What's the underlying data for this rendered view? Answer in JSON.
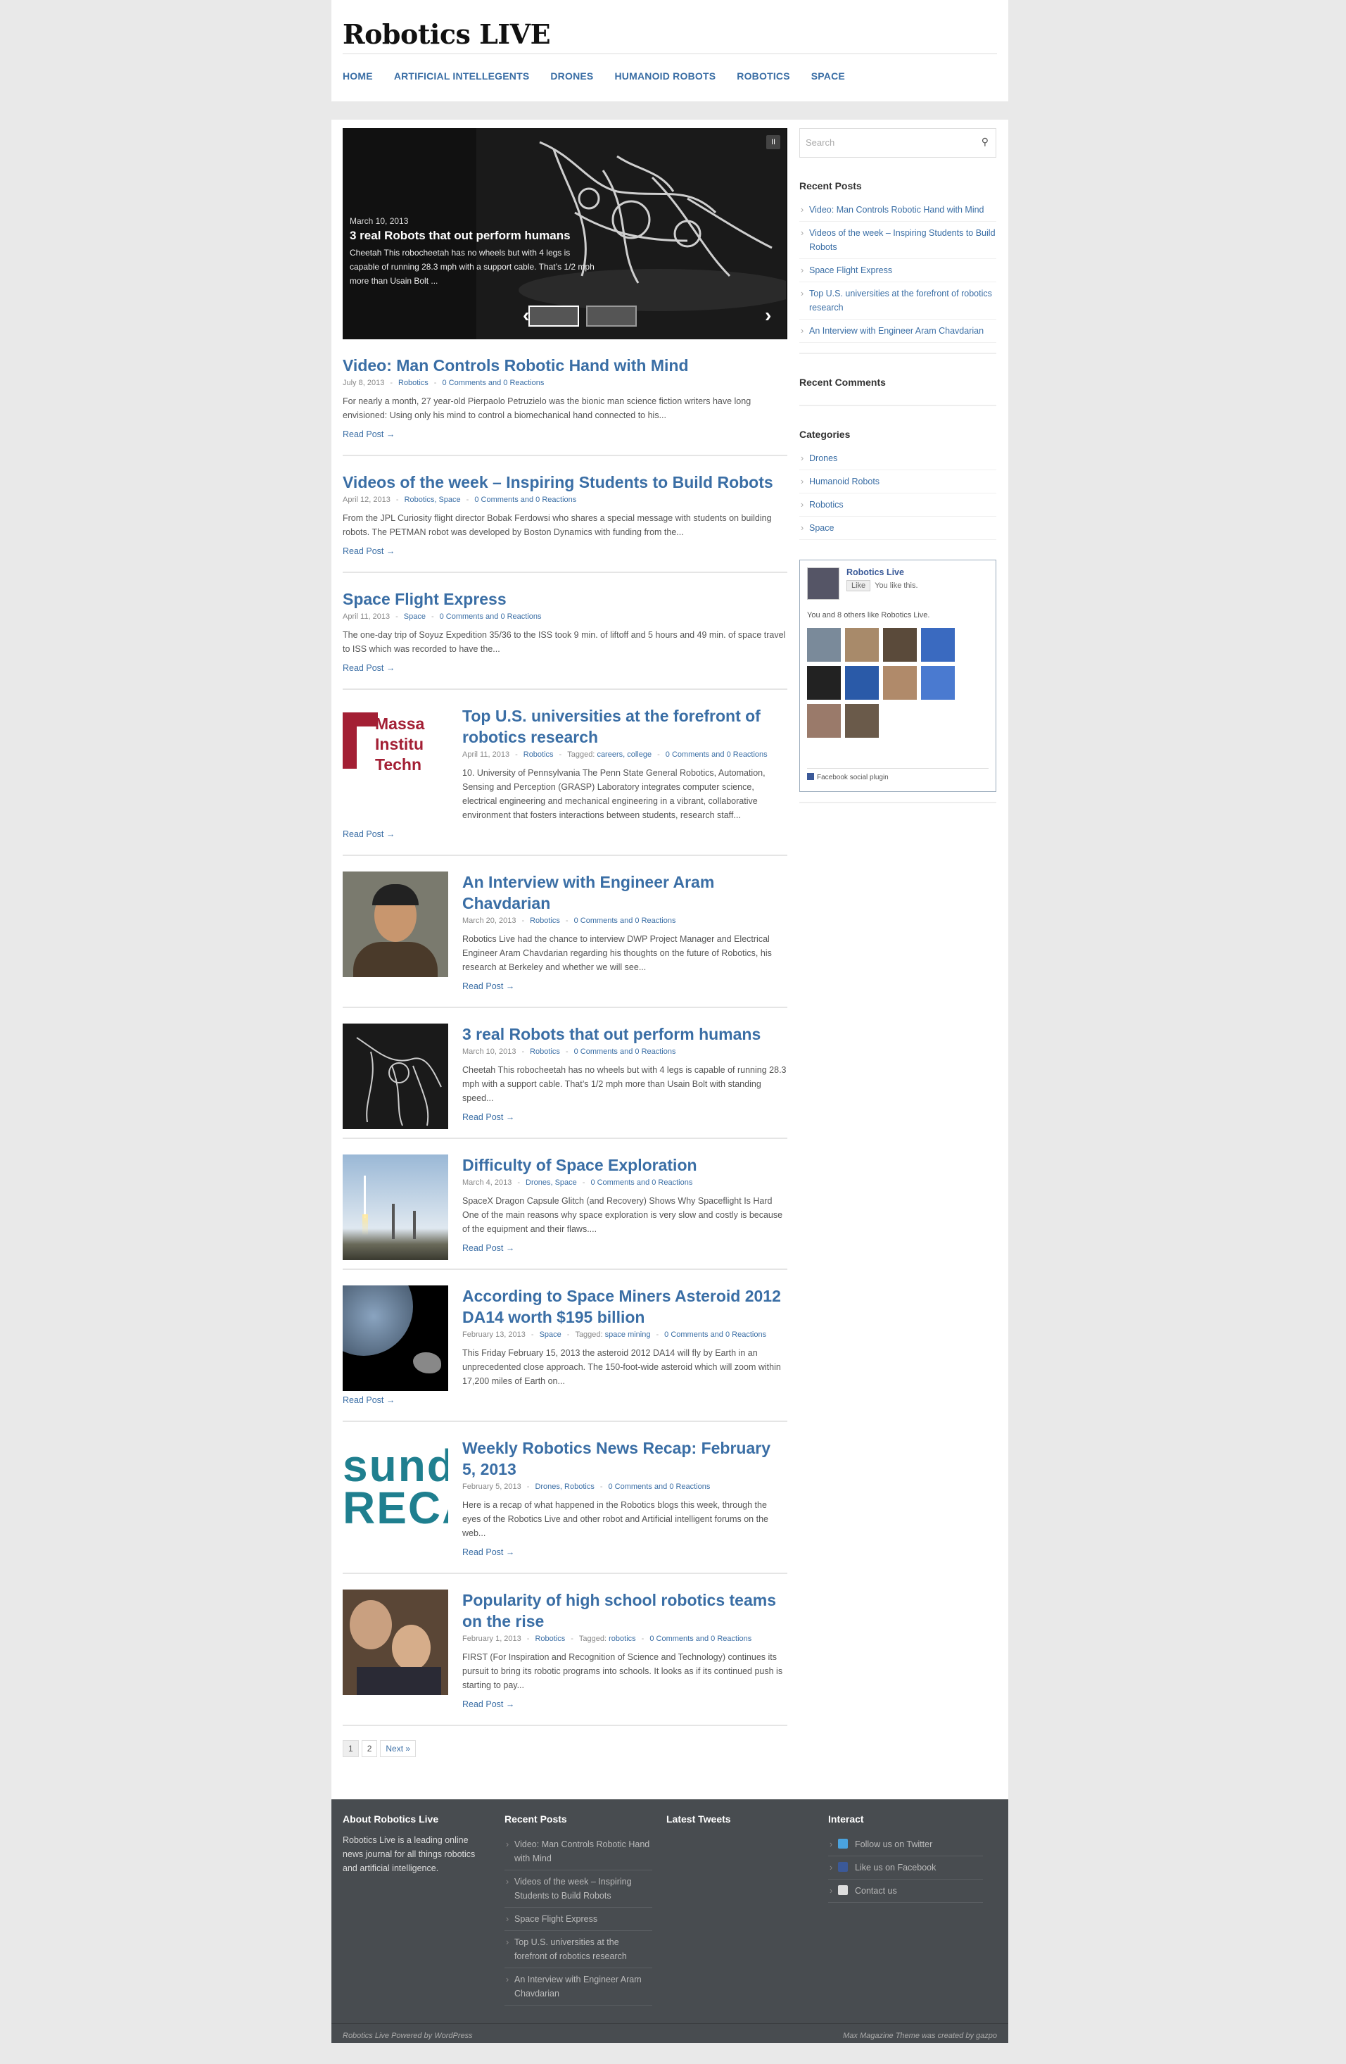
{
  "site": {
    "title": "Robotics LIVE"
  },
  "nav": [
    "HOME",
    "ARTIFICIAL INTELLEGENTS",
    "DRONES",
    "HUMANOID ROBOTS",
    "ROBOTICS",
    "SPACE"
  ],
  "slider": {
    "date": "March 10, 2013",
    "title": "3 real Robots that out perform humans",
    "excerpt": "Cheetah This robocheetah has no wheels but with 4 legs is capable of running 28.3 mph with a support cable. That’s 1/2 mph more than Usain Bolt ...",
    "pause_label": "II",
    "prev": "‹",
    "next": "›"
  },
  "posts": [
    {
      "title": "Video: Man Controls Robotic Hand with Mind",
      "date": "July 8, 2013",
      "cats": "Robotics",
      "tags": "",
      "comments": "0 Comments and 0 Reactions",
      "excerpt": "For nearly a month, 27 year-old Pierpaolo Petruzielo was the bionic man science fiction writers have long envisioned: Using only his mind to control a biomechanical hand connected to his...",
      "more": "Read Post →"
    },
    {
      "title": "Videos of the week – Inspiring Students to Build Robots",
      "date": "April 12, 2013",
      "cats": "Robotics, Space",
      "tags": "",
      "comments": "0 Comments and 0 Reactions",
      "excerpt": "From the JPL  Curiosity flight director Bobak Ferdowsi who shares a special message with students on building robots.      The PETMAN robot was developed by Boston Dynamics with funding from the...",
      "more": "Read Post →"
    },
    {
      "title": "Space Flight Express",
      "date": "April 11, 2013",
      "cats": "Space",
      "tags": "",
      "comments": "0 Comments and 0 Reactions",
      "excerpt": "The one-day trip of Soyuz Expedition 35/36 to the ISS took 9 min. of liftoff and 5 hours and 49 min. of space travel to ISS which was recorded to have the...",
      "more": "Read Post →"
    },
    {
      "title": "Top U.S. universities at the forefront of robotics research",
      "date": "April 11, 2013",
      "cats": "Robotics",
      "tags_label": "Tagged:",
      "tags": "careers, college",
      "comments": "0 Comments and 0 Reactions",
      "excerpt": "10. University of Pennsylvania   The Penn State General Robotics, Automation, Sensing and Perception (GRASP) Laboratory integrates computer science, electrical engineering and mechanical engineering in a vibrant, collaborative environment that fosters interactions between students, research staff...",
      "more": "Read Post →",
      "thumb_text": "Massa Institu Techn"
    },
    {
      "title": "An Interview with Engineer Aram Chavdarian",
      "date": "March 20, 2013",
      "cats": "Robotics",
      "tags": "",
      "comments": "0 Comments and 0 Reactions",
      "excerpt": "Robotics Live had the chance to interview DWP Project Manager and Electrical Engineer Aram Chavdarian regarding his thoughts on the future of Robotics, his research at Berkeley and whether we will see...",
      "more": "Read Post →"
    },
    {
      "title": "3 real Robots that out perform humans",
      "date": "March 10, 2013",
      "cats": "Robotics",
      "tags": "",
      "comments": "0 Comments and 0 Reactions",
      "excerpt": "Cheetah This robocheetah has no wheels but with 4 legs is capable of running 28.3 mph with a support cable. That’s 1/2 mph more than Usain Bolt with standing speed...",
      "more": "Read Post →"
    },
    {
      "title": "Difficulty of Space Exploration",
      "date": "March 4, 2013",
      "cats": "Drones, Space",
      "tags": "",
      "comments": "0 Comments and 0 Reactions",
      "excerpt": "SpaceX Dragon Capsule Glitch (and Recovery) Shows Why Spaceflight Is Hard One of the main reasons why space exploration is very slow and costly is because of the equipment and their flaws....",
      "more": "Read Post →"
    },
    {
      "title": "According to Space Miners Asteroid 2012 DA14 worth $195 billion",
      "date": "February 13, 2013",
      "cats": "Space",
      "tags_label": "Tagged:",
      "tags": "space mining",
      "comments": "0 Comments and 0 Reactions",
      "excerpt": "This Friday February 15, 2013 the asteroid 2012 DA14 will fly by Earth in an unprecedented close approach. The 150-foot-wide asteroid which will zoom within 17,200 miles of Earth on...",
      "more": "Read Post →"
    },
    {
      "title": "Weekly Robotics News Recap: February 5, 2013",
      "date": "February 5, 2013",
      "cats": "Drones, Robotics",
      "tags": "",
      "comments": "0 Comments and 0 Reactions",
      "excerpt": "Here is a recap of what happened in the Robotics blogs this week, through the eyes of the Robotics Live and other robot and Artificial intelligent forums on the web...",
      "more": "Read Post →",
      "thumb_text": "sunda RECAI"
    },
    {
      "title": "Popularity of high school robotics teams on the rise",
      "date": "February 1, 2013",
      "cats": "Robotics",
      "tags_label": "Tagged:",
      "tags": "robotics",
      "comments": "0 Comments and 0 Reactions",
      "excerpt": "FIRST (For Inspiration and Recognition of Science and Technology) continues its pursuit to bring its robotic programs into schools. It looks as if its continued push is starting to pay...",
      "more": "Read Post →"
    }
  ],
  "pagination": [
    "1",
    "2",
    "Next »"
  ],
  "sidebar": {
    "search_placeholder": "Search",
    "recent_posts_title": "Recent Posts",
    "recent_posts": [
      "Video: Man Controls Robotic Hand with Mind",
      "Videos of the week – Inspiring Students to Build Robots",
      "Space Flight Express",
      "Top U.S. universities at the forefront of robotics research",
      "An Interview with Engineer Aram Chavdarian"
    ],
    "recent_comments_title": "Recent Comments",
    "categories_title": "Categories",
    "categories": [
      "Drones",
      "Humanoid Robots",
      "Robotics",
      "Space"
    ],
    "fb": {
      "name": "Robotics Live",
      "like": "Like",
      "you_like": "You like this.",
      "others": "You and 8 others like Robotics Live.",
      "plugin": "Facebook social plugin"
    }
  },
  "footer": {
    "about_title": "About Robotics Live",
    "about_text": "Robotics Live is a leading online news journal for all things robotics and artificial intelligence.",
    "recent_title": "Recent Posts",
    "recent": [
      "Video: Man Controls Robotic Hand with Mind",
      "Videos of the week – Inspiring Students to Build Robots",
      "Space Flight Express",
      "Top U.S. universities at the forefront of robotics research",
      "An Interview with Engineer Aram Chavdarian"
    ],
    "tweets_title": "Latest Tweets",
    "interact_title": "Interact",
    "interact": [
      "Follow us on Twitter",
      "Like us on Facebook",
      "Contact us"
    ],
    "credit_left": "Robotics Live Powered by WordPress",
    "credit_right": "Max Magazine Theme was created by gazpo"
  },
  "colors": {
    "link": "#3a6ea5",
    "footer_bg": "#484c50",
    "page_bg": "#e9e9e9"
  }
}
